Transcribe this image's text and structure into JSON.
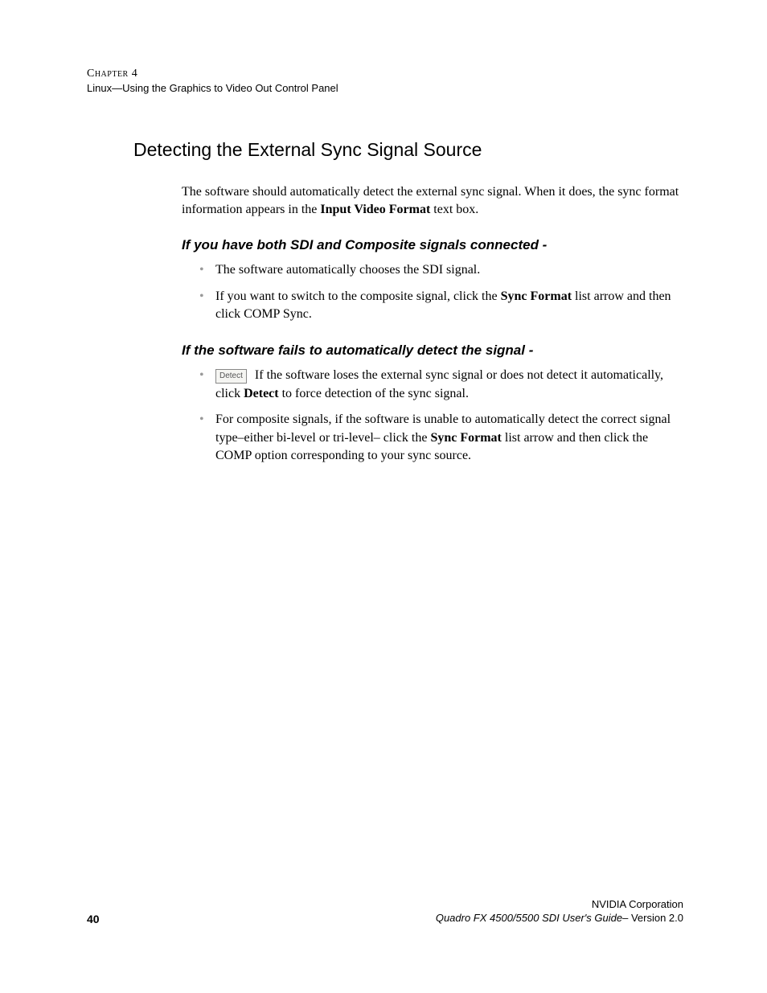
{
  "header": {
    "chapter": "Chapter 4",
    "subtitle": "Linux—Using the Graphics to Video Out Control Panel"
  },
  "title": "Detecting the External Sync Signal Source",
  "intro": {
    "pre": "The software should automatically detect the external sync signal. When it does, the sync format information appears in the ",
    "bold": "Input Video Format",
    "post": " text box."
  },
  "section1": {
    "heading": "If you have both SDI and Composite signals connected -",
    "bullet1": "The software automatically chooses the SDI signal.",
    "bullet2": {
      "pre": "If you want to switch to the composite signal, click the ",
      "bold": "Sync Format",
      "post": " list arrow and then click COMP Sync."
    }
  },
  "section2": {
    "heading": "If the software fails to automatically detect the signal -",
    "bullet1": {
      "btn": "Detect",
      "pre": " If the software loses the external sync signal or does not detect it automatically, click ",
      "bold": "Detect",
      "post": " to force detection of the sync signal."
    },
    "bullet2": {
      "pre": "For composite signals, if the software is unable to automatically detect the correct signal type–either bi-level or tri-level– click the ",
      "bold": "Sync Format",
      "post": " list arrow and then click the COMP option corresponding to your sync source."
    }
  },
  "footer": {
    "page": "40",
    "company": "NVIDIA Corporation",
    "guide": "Quadro FX 4500/5500 SDI User's Guide",
    "version": "– Version 2.0"
  }
}
